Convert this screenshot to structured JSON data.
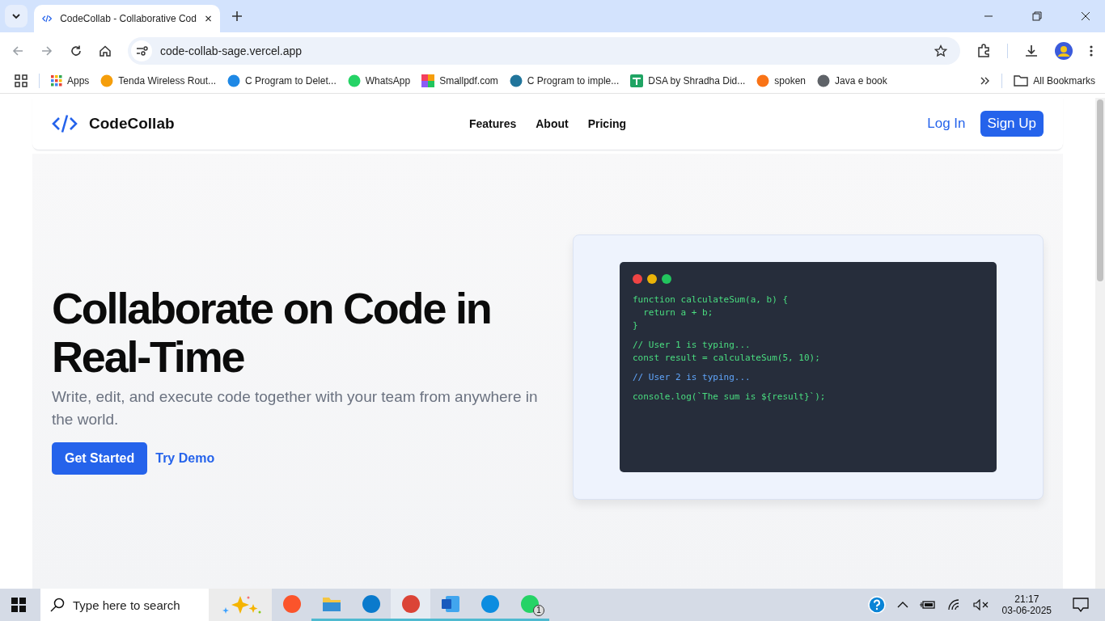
{
  "browser": {
    "tab": {
      "title": "CodeCollab - Collaborative Cod",
      "selected": true
    },
    "address": "code-collab-sage.vercel.app",
    "bookmarks": [
      {
        "kind": "apps",
        "label": "Apps"
      },
      {
        "kind": "tenda",
        "label": "Tenda Wireless Rout..."
      },
      {
        "kind": "wave",
        "label": "C Program to Delet..."
      },
      {
        "kind": "whatsapp",
        "label": "WhatsApp"
      },
      {
        "kind": "smallpdf",
        "label": "Smallpdf.com"
      },
      {
        "kind": "wordpress",
        "label": "C Program to imple..."
      },
      {
        "kind": "sheets",
        "label": "DSA by Shradha Did..."
      },
      {
        "kind": "spoken",
        "label": "spoken"
      },
      {
        "kind": "globe",
        "label": "Java e book"
      }
    ],
    "all_bookmarks": "All Bookmarks"
  },
  "site": {
    "brand": "CodeCollab",
    "nav": [
      "Features",
      "About",
      "Pricing"
    ],
    "login": "Log In",
    "signup": "Sign Up",
    "hero": {
      "title": "Collaborate on Code in Real-Time",
      "subtitle": "Write, edit, and execute code together with your team from anywhere in the world.",
      "primary": "Get Started",
      "secondary": "Try Demo"
    },
    "code": {
      "dots": [
        {
          "color": "#ef4444"
        },
        {
          "color": "#eab308"
        },
        {
          "color": "#22c55e"
        }
      ],
      "blocks": [
        {
          "color": "#4ade80",
          "lines": [
            "function calculateSum(a, b) {",
            "  return a + b;",
            "}"
          ]
        },
        {
          "color": "#4ade80",
          "lines": [
            "// User 1 is typing...",
            "const result = calculateSum(5, 10);"
          ]
        },
        {
          "color": "#60a5fa",
          "lines": [
            "// User 2 is typing..."
          ]
        },
        {
          "color": "#4ade80",
          "lines": [
            "console.log(`The sum is ${result}`);"
          ]
        }
      ]
    }
  },
  "taskbar": {
    "search_placeholder": "Type here to search",
    "apps": [
      {
        "kind": "brave",
        "running": false,
        "selected": false
      },
      {
        "kind": "folder",
        "running": true,
        "selected": false
      },
      {
        "kind": "vscode",
        "running": true,
        "selected": false
      },
      {
        "kind": "chrome",
        "running": true,
        "selected": true
      },
      {
        "kind": "word",
        "running": true,
        "selected": false
      },
      {
        "kind": "edge",
        "running": true,
        "selected": false
      },
      {
        "kind": "whatsapp",
        "running": true,
        "selected": false,
        "badge": "1"
      }
    ],
    "time": "21:17",
    "date": "03-06-2025"
  }
}
